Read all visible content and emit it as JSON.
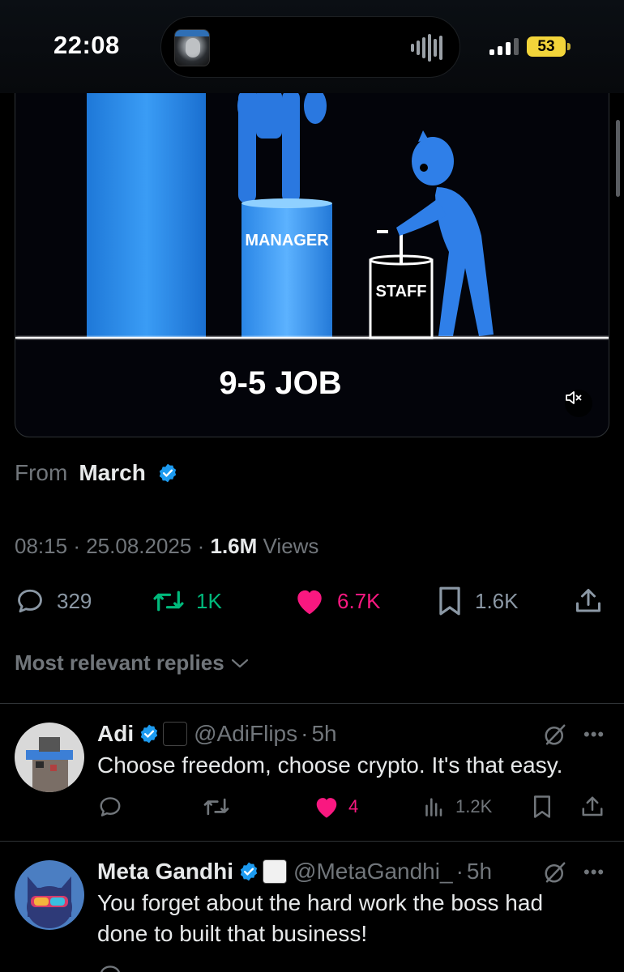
{
  "status_bar": {
    "time": "22:08",
    "battery": "53"
  },
  "video": {
    "labels": {
      "manager": "MANAGER",
      "staff": "STAFF",
      "caption": "9-5 JOB"
    },
    "mute_icon": "speaker-muted-icon"
  },
  "source": {
    "prefix": "From",
    "app": "March"
  },
  "meta": {
    "time": "08:15",
    "date": "25.08.2025",
    "views_count": "1.6M",
    "views_label": "Views",
    "sep": "·"
  },
  "stats": {
    "replies": "329",
    "reposts": "1K",
    "likes": "6.7K",
    "bookmarks": "1.6K"
  },
  "sort_label": "Most relevant replies",
  "replies": [
    {
      "name": "Adi",
      "handle": "@AdiFlips",
      "time": "5h",
      "text": "Choose freedom, choose crypto. It's that easy.",
      "likes": "4",
      "views": "1.2K"
    },
    {
      "name": "Meta Gandhi",
      "handle": "@MetaGandhi_",
      "time": "5h",
      "text": "You forget about the hard work the boss  had done to built that business!"
    }
  ],
  "colors": {
    "accent": "#1d9bf0",
    "repost": "#00ba7c",
    "like": "#f91880",
    "muted": "#71767b"
  }
}
